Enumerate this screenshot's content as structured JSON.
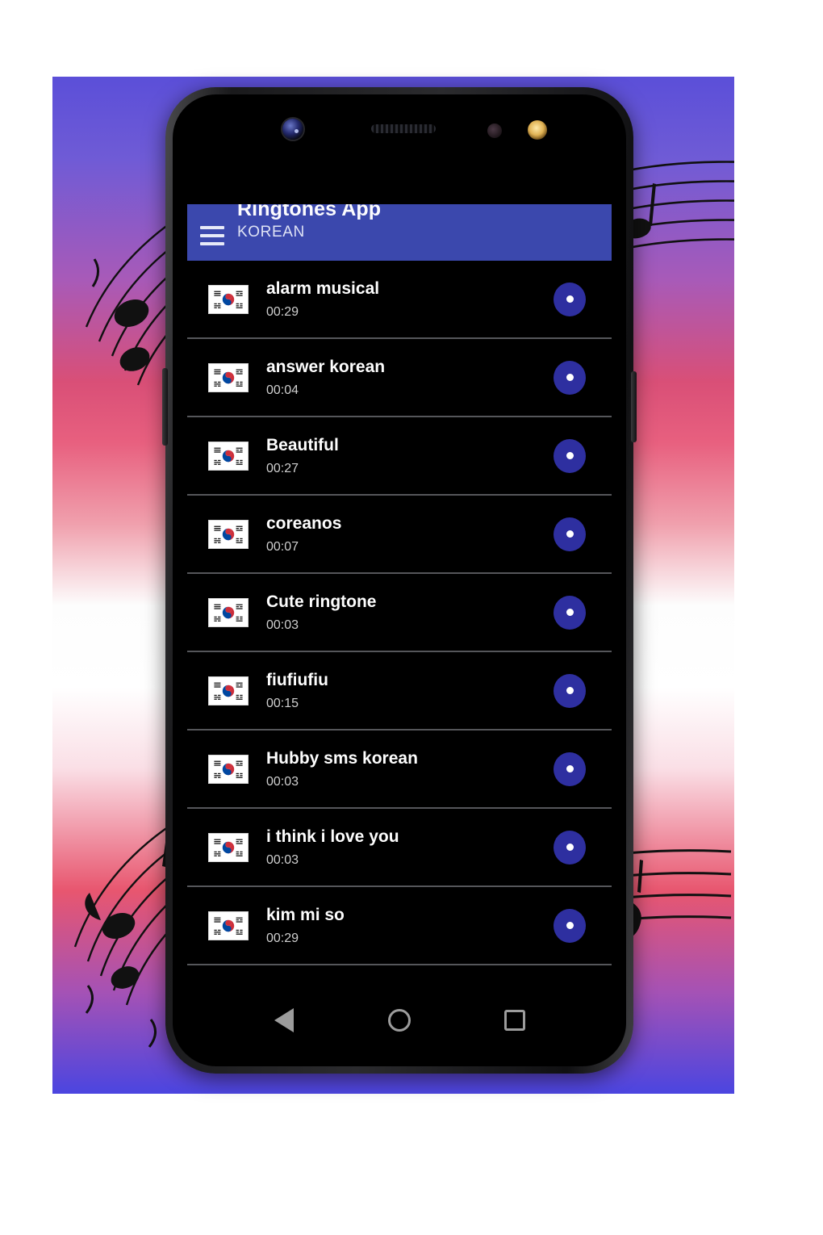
{
  "app": {
    "title": "Ringtones App",
    "subtitle": "KOREAN",
    "menu_icon": "hamburger-menu-icon",
    "header_color": "#3b48ad",
    "accent_color": "#2e2fa0",
    "screen_background": "#000000"
  },
  "ringtones": [
    {
      "title": "alarm musical",
      "duration": "00:29",
      "thumb": "south-korea-flag-icon"
    },
    {
      "title": "answer korean",
      "duration": "00:04",
      "thumb": "south-korea-flag-icon"
    },
    {
      "title": "Beautiful",
      "duration": "00:27",
      "thumb": "south-korea-flag-icon"
    },
    {
      "title": "coreanos",
      "duration": "00:07",
      "thumb": "south-korea-flag-icon"
    },
    {
      "title": "Cute ringtone",
      "duration": "00:03",
      "thumb": "south-korea-flag-icon"
    },
    {
      "title": "fiufiufiu",
      "duration": "00:15",
      "thumb": "south-korea-flag-icon"
    },
    {
      "title": "Hubby sms korean",
      "duration": "00:03",
      "thumb": "south-korea-flag-icon"
    },
    {
      "title": "i think i love you",
      "duration": "00:03",
      "thumb": "south-korea-flag-icon"
    },
    {
      "title": "kim mi so",
      "duration": "00:29",
      "thumb": "south-korea-flag-icon"
    }
  ],
  "nav_bar": {
    "back": "back-triangle-icon",
    "home": "home-circle-icon",
    "recents": "recents-square-icon"
  },
  "device": {
    "front_camera": "front-camera-icon",
    "earpiece": "earpiece-speaker-icon",
    "proximity_sensor": "proximity-sensor-icon",
    "led": "led-indicator-icon",
    "volume_button": "volume-button",
    "power_button": "power-button"
  },
  "background": {
    "description": "music-staff-artwork",
    "gradient_top": "#5b4fd8",
    "gradient_mid": "#e8607f",
    "gradient_bottom": "#4b45e0"
  }
}
